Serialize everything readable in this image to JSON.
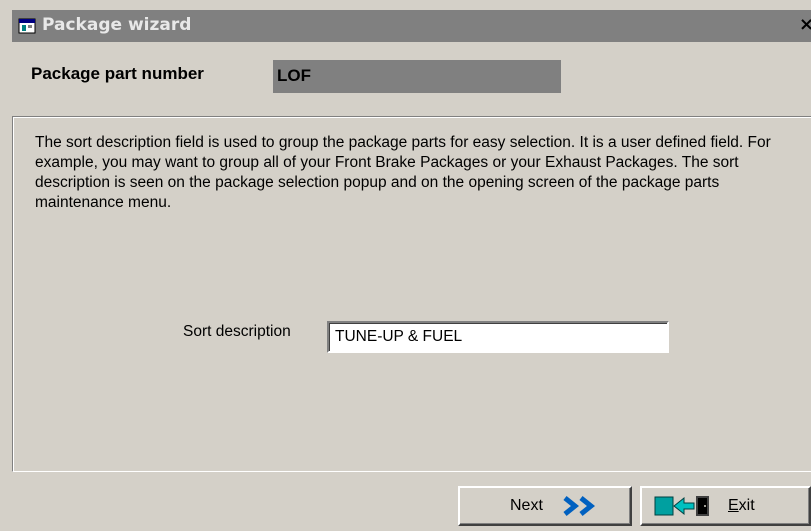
{
  "window": {
    "title": "Package wizard",
    "close_glyph": "×",
    "app_icon": "wizard-window-icon"
  },
  "header": {
    "part_number_label": "Package part number",
    "part_number_value": "LOF"
  },
  "content": {
    "description": "The sort description field is used to group the package parts for easy selection.  It is a user defined field.  For example, you may want to group all of your Front Brake Packages or your Exhaust Packages.  The sort description is seen on the package selection popup and on the opening screen of the package parts maintenance menu.",
    "sort_description_label": "Sort description",
    "sort_description_value": "TUNE-UP & FUEL"
  },
  "buttons": {
    "next_label": "Next",
    "next_icon": "double-chevron-right-icon",
    "exit_label_accel": "E",
    "exit_label_rest": "xit",
    "exit_icon": "exit-door-icon"
  },
  "colors": {
    "background": "#d4d0c8",
    "titlebar": "#808080",
    "field_gray": "#808080",
    "next_arrow": "#0060c0",
    "exit_icon_accent": "#00a0a0"
  }
}
